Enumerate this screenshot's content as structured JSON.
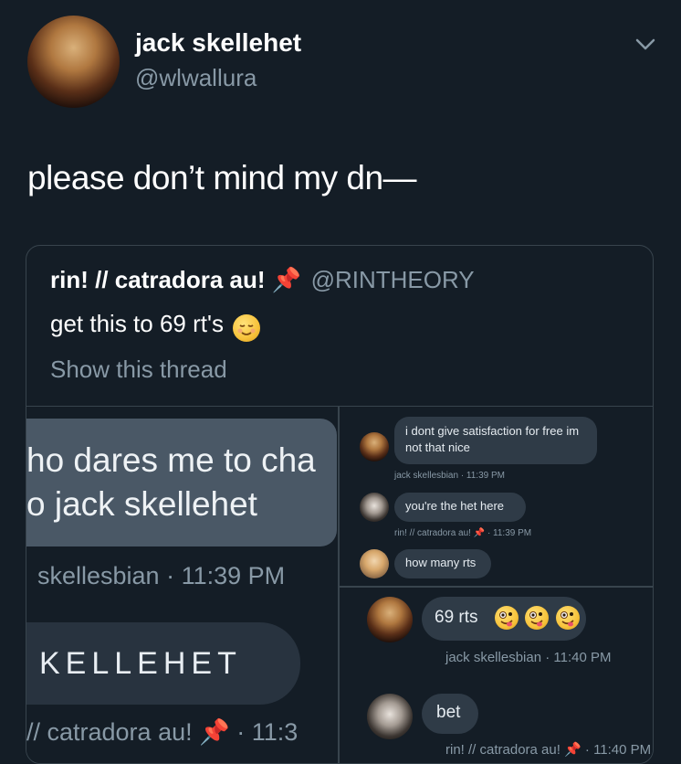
{
  "tweet": {
    "author_name": "jack skellehet",
    "author_handle": "@wlwallura",
    "text": "please don’t mind my dn—"
  },
  "quoted": {
    "name": "rin! // catradora au! 📌",
    "handle": "@RINTHEORY",
    "text": "get this to 69 rt's",
    "thread_link": "Show this thread"
  },
  "left_image": {
    "line1": "ho dares me to cha",
    "line2": "o jack skellehet",
    "meta1": "skellesbian · 11:39 PM",
    "bubble": "KELLEHET",
    "meta2": "// catradora au! 📌 · 11:3"
  },
  "top_right_image": {
    "msg1": "i dont give satisfaction for free im not that nice",
    "meta1": "jack skellesbian · 11:39 PM",
    "msg2": "you're the het here",
    "meta2": "rin! // catradora au! 📌 · 11:39 PM",
    "msg3": "how many rts"
  },
  "bottom_right_image": {
    "msg1": "69 rts",
    "meta1": "jack skellesbian · 11:40 PM",
    "msg2": "bet",
    "meta2": "rin! // catradora au! 📌 · 11:40 PM"
  },
  "icons": {
    "chevron": "chevron-down-icon",
    "emoji_relieved": "relieved-face-emoji",
    "emoji_zany": "zany-face-emoji"
  },
  "colors": {
    "background": "#141d26",
    "secondary_text": "#8899a6",
    "border": "#38444d",
    "bubble_light": "#4a5866",
    "bubble_dark": "#28333f"
  }
}
